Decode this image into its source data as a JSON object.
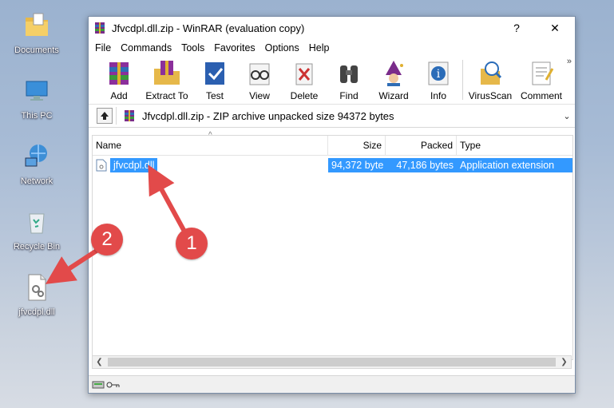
{
  "desktop": {
    "icons": [
      {
        "label": "Documents"
      },
      {
        "label": "This PC"
      },
      {
        "label": "Network"
      },
      {
        "label": "Recycle Bin"
      },
      {
        "label": "jfvcdpl.dll"
      }
    ]
  },
  "window": {
    "title": "Jfvcdpl.dll.zip - WinRAR (evaluation copy)",
    "help_button": "?",
    "close_button": "✕"
  },
  "menu": [
    "File",
    "Commands",
    "Tools",
    "Favorites",
    "Options",
    "Help"
  ],
  "toolbar": {
    "buttons": [
      "Add",
      "Extract To",
      "Test",
      "View",
      "Delete",
      "Find",
      "Wizard",
      "Info",
      "VirusScan",
      "Comment"
    ],
    "more": "»"
  },
  "address": {
    "path": "Jfvcdpl.dll.zip - ZIP archive unpacked size 94372 bytes"
  },
  "list": {
    "columns": [
      "Name",
      "Size",
      "Packed",
      "Type"
    ],
    "rows": [
      {
        "name": "jfvcdpl.dll",
        "size": "94,372 byte",
        "packed": "47,186 bytes",
        "type": "Application extension"
      }
    ]
  },
  "annotations": {
    "badge1": "1",
    "badge2": "2",
    "color": "#e24a4a"
  }
}
